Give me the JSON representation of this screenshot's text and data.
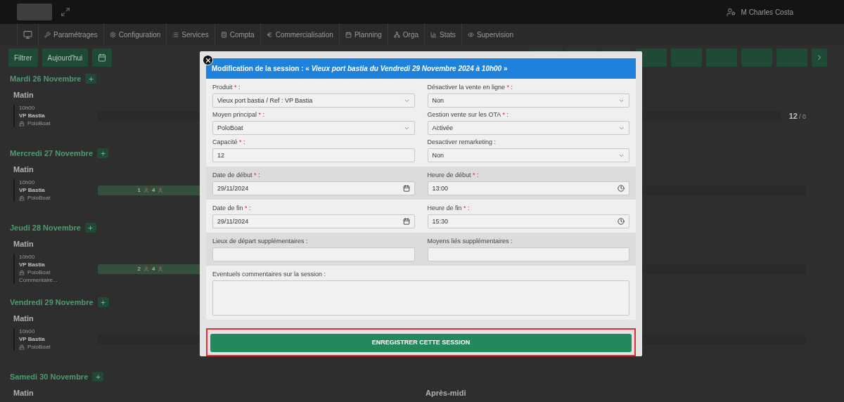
{
  "topbar": {
    "user": "M Charles Costa"
  },
  "nav": {
    "items": [
      "Paramétrages",
      "Configuration",
      "Services",
      "Compta",
      "Commercialisation",
      "Planning",
      "Orga",
      "Stats",
      "Supervision"
    ]
  },
  "toolbar": {
    "buttons": [
      "Filtrer",
      "Aujourd'hui"
    ]
  },
  "days": [
    {
      "title": "Mardi 26 Novembre",
      "period": "Matin",
      "session": {
        "time": "10h00",
        "name": "VP Bastia",
        "boat": "PoloBoat"
      },
      "count": "12",
      "count_sub": "/ 0"
    },
    {
      "title": "Mercredi 27 Novembre",
      "period": "Matin",
      "session": {
        "time": "10h00",
        "name": "VP Bastia",
        "boat": "PoloBoat"
      },
      "bar": [
        "1",
        "4"
      ]
    },
    {
      "title": "Jeudi 28 Novembre",
      "period": "Matin",
      "session": {
        "time": "10h00",
        "name": "VP Bastia",
        "boat": "PoloBoat",
        "note": "Commentaire..."
      },
      "bar": [
        "2",
        "4"
      ]
    },
    {
      "title": "Vendredi 29 Novembre",
      "period": "Matin",
      "session": {
        "time": "10h00",
        "name": "VP Bastia",
        "boat": "PoloBoat"
      }
    },
    {
      "title": "Samedi 30 Novembre",
      "period": "Matin",
      "period2": "Après-midi"
    }
  ],
  "modal": {
    "title": "Modification de la session : « *Vieux port bastia du Vendredi 29 Novembre 2024 à 10h00* »",
    "sections": [
      {
        "rows": [
          [
            {
              "label": "Produit",
              "star": "*",
              "after": ":",
              "kind": "select",
              "value": "Vieux port bastia / Ref : VP Bastia"
            },
            {
              "label": "Désactiver la vente en ligne",
              "star": "*",
              "after": ":",
              "kind": "select",
              "value": "Non"
            }
          ],
          [
            {
              "label": "Moyen principal",
              "star": "*",
              "after": ":",
              "kind": "select",
              "value": "PoloBoat"
            },
            {
              "label": "Gestion vente sur les OTA",
              "star": "*",
              "after": ":",
              "kind": "select",
              "value": "Activée"
            }
          ],
          [
            {
              "label": "Capacité",
              "star": "*",
              "after": ":",
              "kind": "text",
              "value": "12"
            },
            {
              "label": "Desactiver remarketing :",
              "kind": "select",
              "value": "Non"
            }
          ]
        ]
      },
      {
        "rows": [
          [
            {
              "label": "Date de début",
              "star": "*",
              "after": ":",
              "kind": "date",
              "value": "29/11/2024"
            },
            {
              "label": "Heure de début",
              "star": "*",
              "after": ":",
              "kind": "time",
              "value": "13:00"
            }
          ]
        ]
      },
      {
        "rows": [
          [
            {
              "label": "Date de fin",
              "star": "*",
              "after": ":",
              "kind": "date",
              "value": "29/11/2024"
            },
            {
              "label": "Heure de fin",
              "star": "*",
              "after": ":",
              "kind": "time",
              "value": "15:30"
            }
          ]
        ]
      },
      {
        "rows": [
          [
            {
              "label": "Lieux de départ supplémentaires :",
              "kind": "text"
            },
            {
              "label": "Moyens liés supplémentaires :",
              "kind": "text"
            }
          ]
        ]
      },
      {
        "rows": [
          [
            {
              "label": "Eventuels commentaires sur la session :",
              "kind": "textarea"
            }
          ]
        ]
      }
    ],
    "submit": "ENREGISTRER CETTE SESSION",
    "highlighted": true
  }
}
